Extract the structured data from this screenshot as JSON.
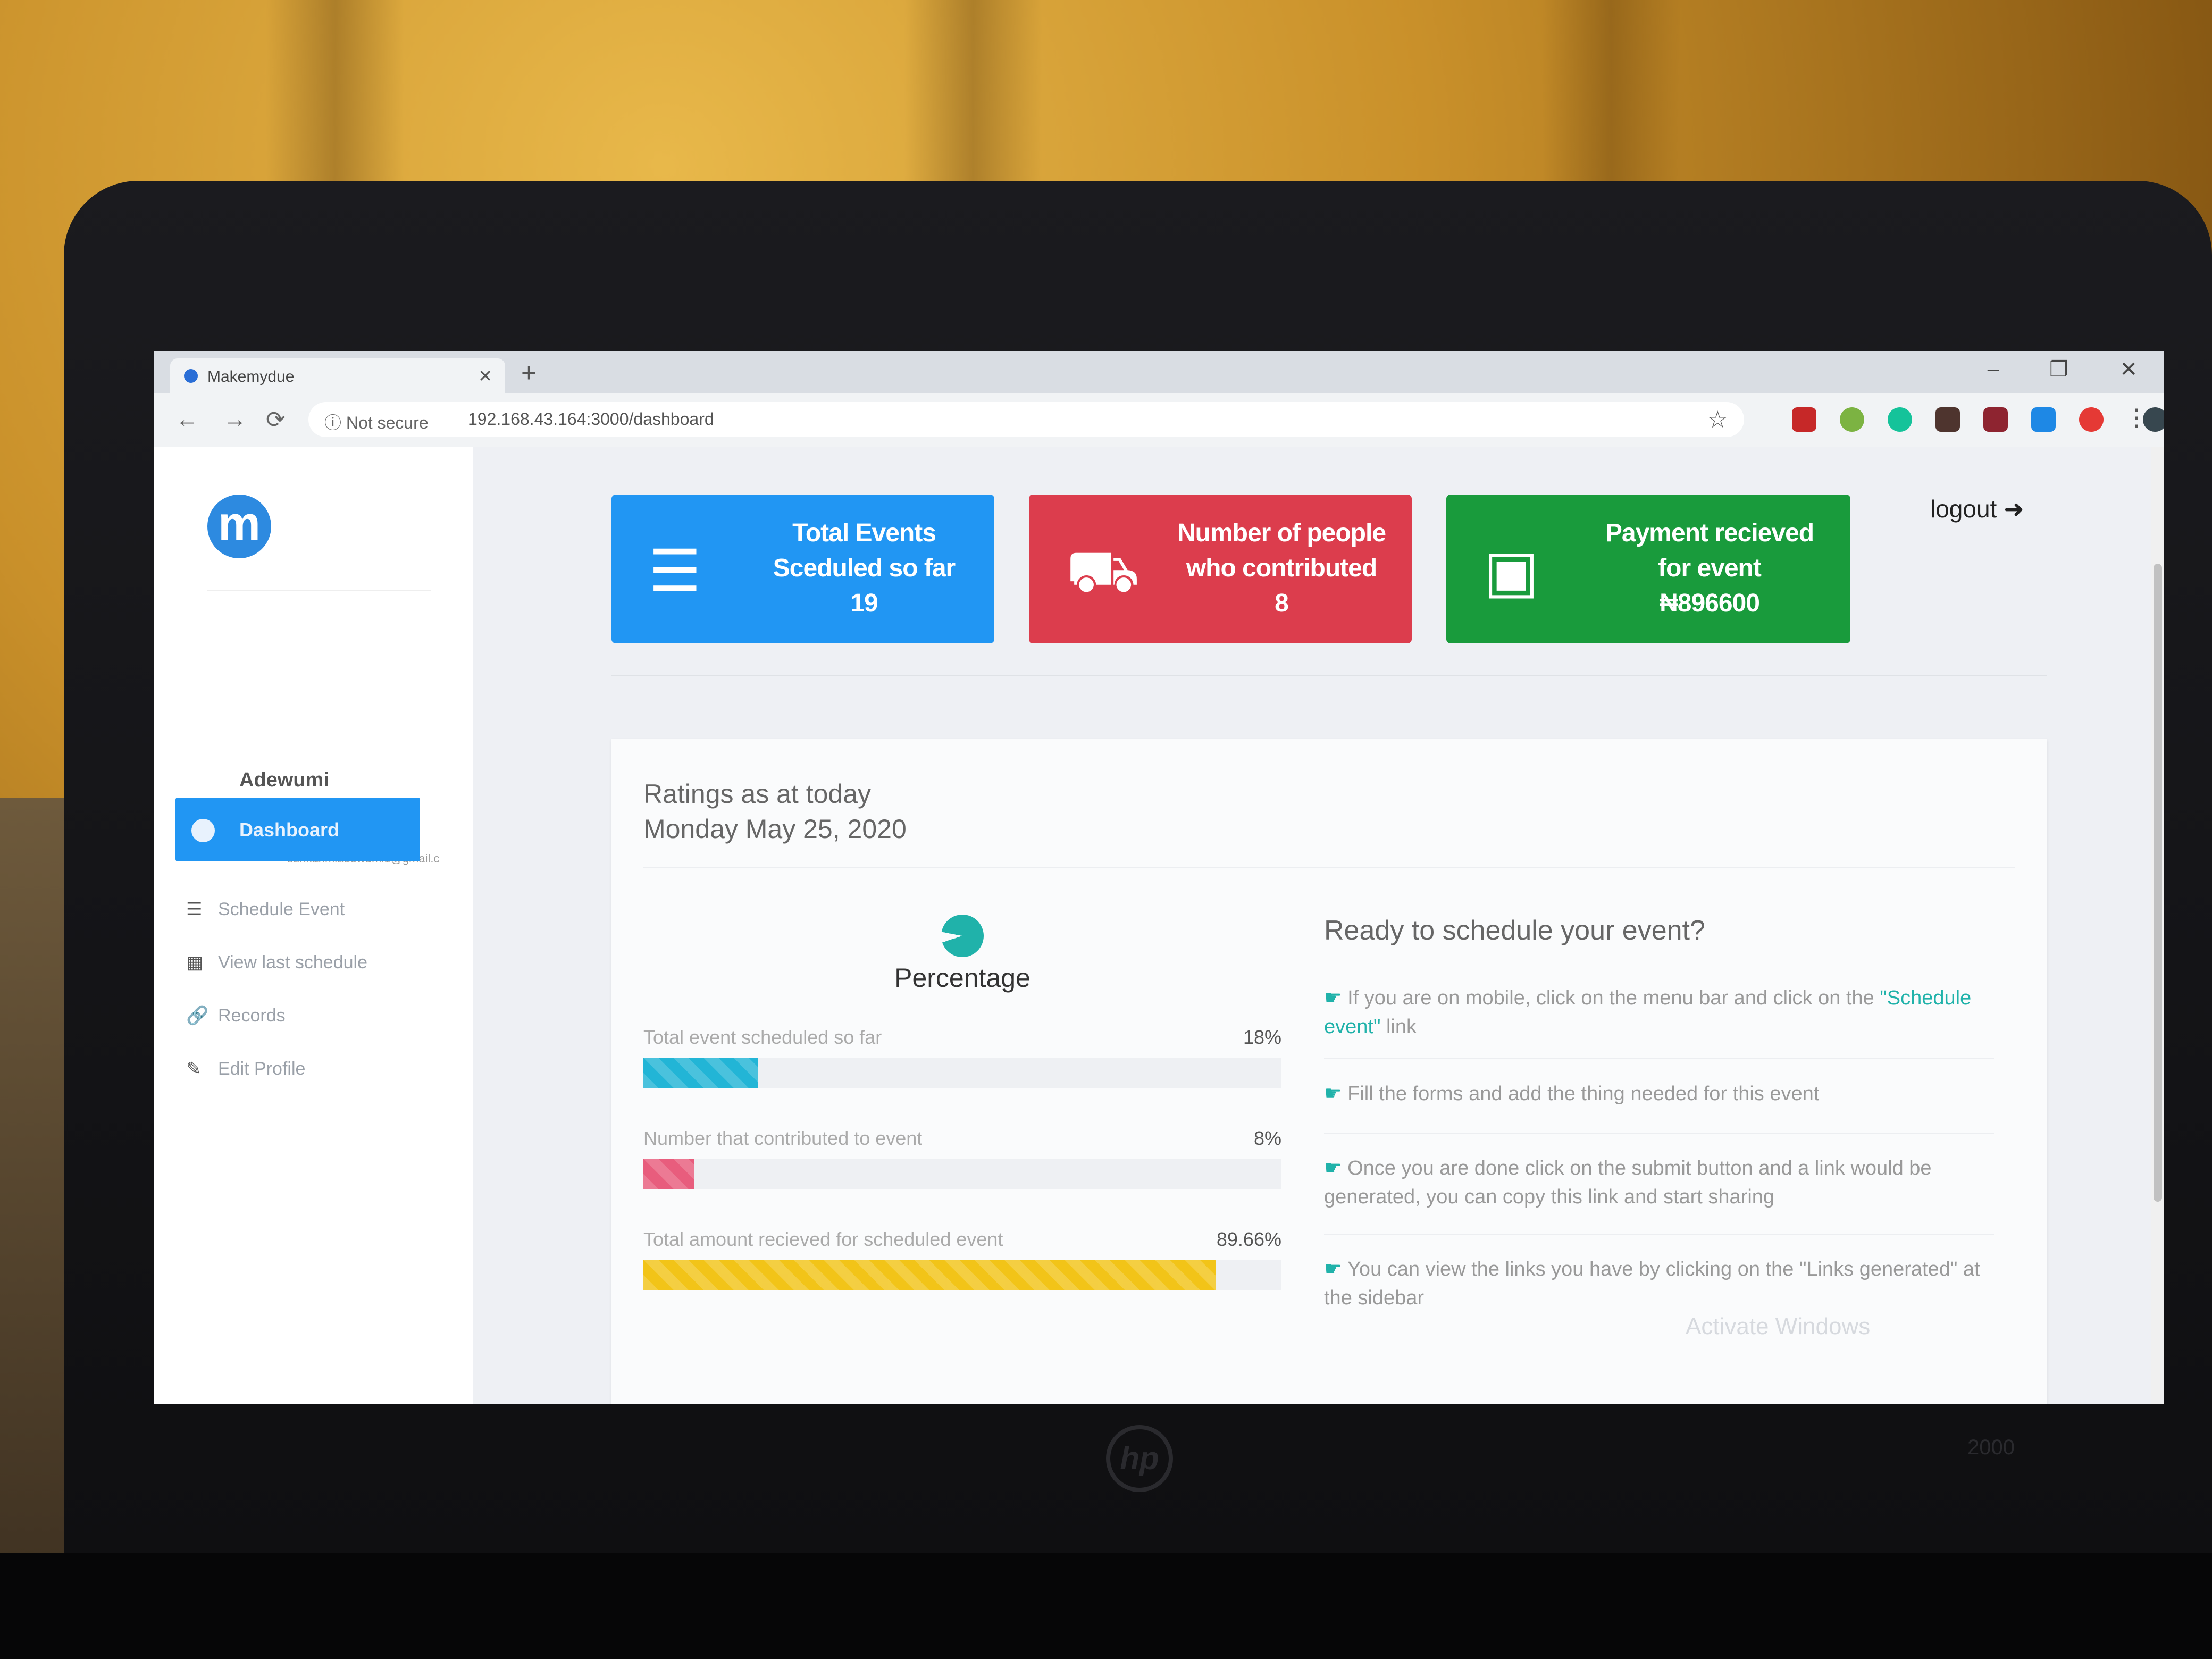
{
  "browser": {
    "tab_title": "Makemydue",
    "tab_close": "✕",
    "new_tab": "+",
    "security_label": "ⓘ Not secure",
    "url": "192.168.43.164:3000/dashboard",
    "star_icon": "☆",
    "window_controls": {
      "minimize": "–",
      "restore": "❐",
      "close": "✕"
    }
  },
  "sidebar": {
    "logo_letter": "m",
    "user_name": "Adewumi Sunkanmi",
    "user_email": "sunkanmiadewumi1@gmail.c",
    "items": [
      {
        "icon": "●",
        "label": "Dashboard",
        "active": true
      },
      {
        "icon": "☰",
        "label": "Schedule Event"
      },
      {
        "icon": "▦",
        "label": "View last schedule"
      },
      {
        "icon": "🔗",
        "label": "Records"
      },
      {
        "icon": "✎",
        "label": "Edit Profile"
      }
    ]
  },
  "header": {
    "logout_label": "logout",
    "logout_icon": "➜"
  },
  "cards": {
    "events": {
      "line1": "Total Events",
      "line2": "Sceduled so far",
      "value": "19",
      "icon": "☰",
      "color": "#2196f3"
    },
    "people": {
      "line1": "Number of people",
      "line2": "who contributed",
      "value": "8",
      "icon": "⛟",
      "color": "#dc3d4d"
    },
    "payment": {
      "line1": "Payment recieved",
      "line2": "for event",
      "value": "₦896600",
      "icon": "▣",
      "color": "#199b3c"
    }
  },
  "ratings": {
    "title": "Ratings as at today",
    "date": "Monday May 25, 2020",
    "chart_title": "Percentage",
    "bars": [
      {
        "label": "Total event scheduled so far",
        "value_text": "18%",
        "value": 18,
        "color": "#22b5d6"
      },
      {
        "label": "Number that contributed to event",
        "value_text": "8%",
        "value": 8,
        "color": "#e85d7d"
      },
      {
        "label": "Total amount recieved for scheduled event",
        "value_text": "89.66%",
        "value": 89.66,
        "color": "#f2c418"
      }
    ]
  },
  "schedule": {
    "title": "Ready to schedule your event?",
    "tip1_a": "If you are on mobile, click on the menu bar and click on the",
    "tip1_link": "\"Schedule event\"",
    "tip1_b": "link",
    "tip2": "Fill the forms and add the thing needed for this event",
    "tip3": "Once you are done click on the submit button and a link would be generated, you can copy this link and start sharing",
    "tip4": "You can view the links you have by clicking on the \"Links generated\" at the sidebar",
    "hand_icon": "☛"
  },
  "watermark": "Activate Windows",
  "laptop": {
    "brand": "hp",
    "model": "2000"
  }
}
